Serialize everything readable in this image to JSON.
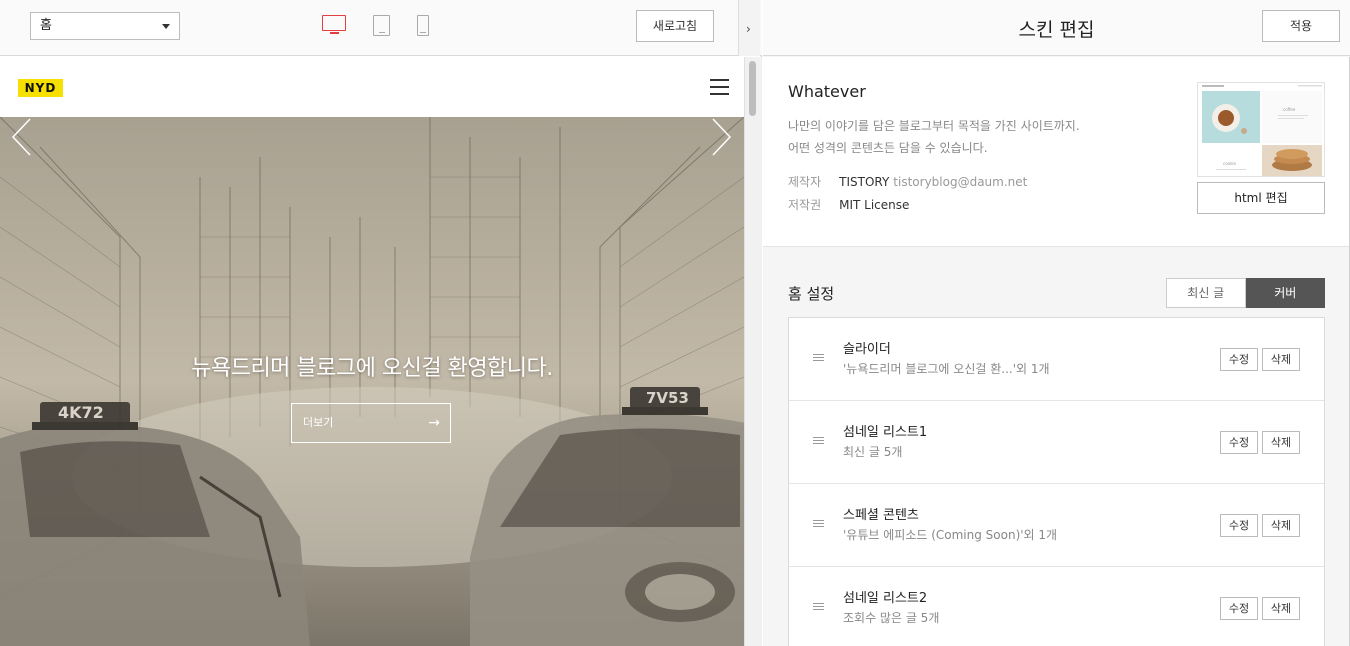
{
  "preview_toolbar": {
    "page_select_value": "홈",
    "refresh_label": "새로고침",
    "collapse_glyph": "›"
  },
  "site": {
    "logo_text": "NYD",
    "hero_title": "뉴욕드리머 블로그에 오신걸 환영합니다.",
    "more_label": "더보기",
    "more_arrow": "→",
    "plate_left": "4K72",
    "plate_right": "7V53"
  },
  "editor": {
    "title": "스킨 편집",
    "apply_label": "적용",
    "skin": {
      "name": "Whatever",
      "desc_line1": "나만의 이야기를 담은 블로그부터 목적을 가진 사이트까지.",
      "desc_line2": "어떤 성격의 콘텐츠든 담을 수 있습니다.",
      "maker_label": "제작자",
      "maker_name": "TISTORY",
      "maker_email": "tistoryblog@daum.net",
      "license_label": "저작권",
      "license_value": "MIT License",
      "html_edit_label": "html 편집",
      "thumb_word1": "coffee",
      "thumb_word2": "cookie"
    },
    "home": {
      "title": "홈 설정",
      "tab_recent": "최신 글",
      "tab_cover": "커버",
      "items": [
        {
          "title": "슬라이더",
          "sub": "'뉴욕드리머 블로그에 오신걸 환...'외 1개",
          "edit": "수정",
          "delete": "삭제"
        },
        {
          "title": "섬네일 리스트1",
          "sub": "최신 글 5개",
          "edit": "수정",
          "delete": "삭제"
        },
        {
          "title": "스페셜 콘텐츠",
          "sub": "'유튜브 에피소드 (Coming Soon)'외 1개",
          "edit": "수정",
          "delete": "삭제"
        },
        {
          "title": "섬네일 리스트2",
          "sub": "조회수 많은 글 5개",
          "edit": "수정",
          "delete": "삭제"
        }
      ]
    }
  },
  "icons": [
    "chevron-down-icon",
    "desktop-icon",
    "tablet-icon",
    "mobile-icon",
    "hamburger-icon",
    "arrow-left-icon",
    "arrow-right-icon",
    "drag-handle-icon"
  ],
  "colors": {
    "active_device": "#e53e3e",
    "logo_bg": "#f5e000",
    "segment_active": "#555555"
  }
}
